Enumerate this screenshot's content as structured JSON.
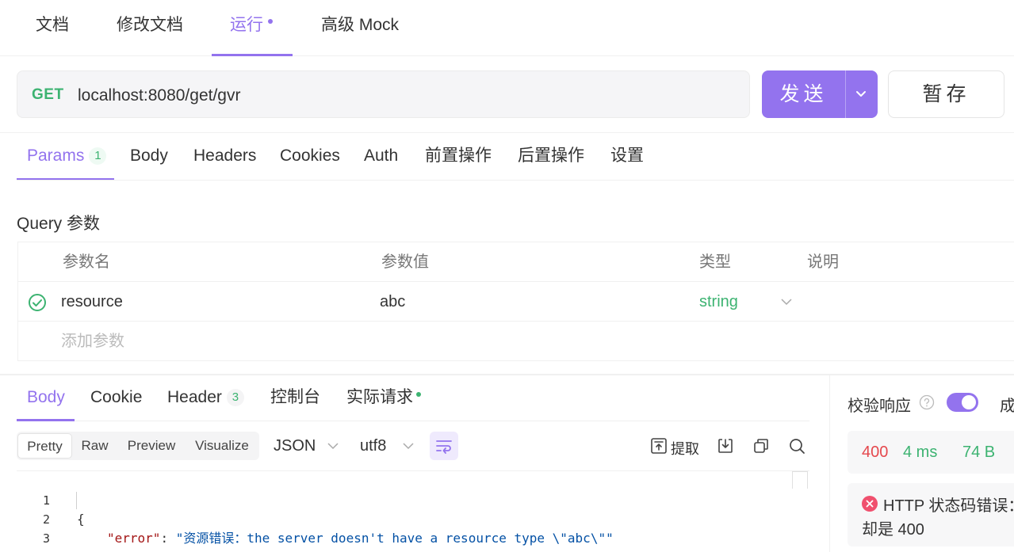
{
  "top_tabs": {
    "doc": "文档",
    "edit_doc": "修改文档",
    "run": "运行",
    "mock": "高级 Mock"
  },
  "request": {
    "method": "GET",
    "url": "localhost:8080/get/gvr",
    "send_label": "发送",
    "save_label": "暂存"
  },
  "param_tabs": {
    "params": "Params",
    "params_count": "1",
    "body": "Body",
    "headers": "Headers",
    "cookies": "Cookies",
    "auth": "Auth",
    "pre": "前置操作",
    "post": "后置操作",
    "settings": "设置"
  },
  "query": {
    "title": "Query 参数",
    "headers": {
      "name": "参数名",
      "value": "参数值",
      "type": "类型",
      "desc": "说明"
    },
    "rows": [
      {
        "name": "resource",
        "value": "abc",
        "type": "string"
      }
    ],
    "add_placeholder": "添加参数"
  },
  "response_tabs": {
    "body": "Body",
    "cookie": "Cookie",
    "header": "Header",
    "header_count": "3",
    "console": "控制台",
    "actual": "实际请求"
  },
  "view_modes": [
    "Pretty",
    "Raw",
    "Preview",
    "Visualize"
  ],
  "format": {
    "type": "JSON",
    "encoding": "utf8",
    "extract": "提取"
  },
  "code": {
    "line_numbers": [
      "1",
      "2",
      "3"
    ],
    "open_brace": "{",
    "key": "\"error\"",
    "colon": ": ",
    "value": "\"资源错误：the server doesn't have a resource type \\\"abc\\\"\"",
    "close_brace": "}"
  },
  "verify": {
    "label": "校验响应",
    "cut_text": "成",
    "status": "400",
    "time": "4 ms",
    "size": "74 B",
    "error_line1": "HTTP 状态码错误：",
    "error_line2": "却是 400"
  },
  "colors": {
    "accent": "#9373ee",
    "method_green": "#3cb371",
    "status_red": "#e5484d",
    "string_blue": "#0451a5",
    "key_red": "#a31515"
  }
}
